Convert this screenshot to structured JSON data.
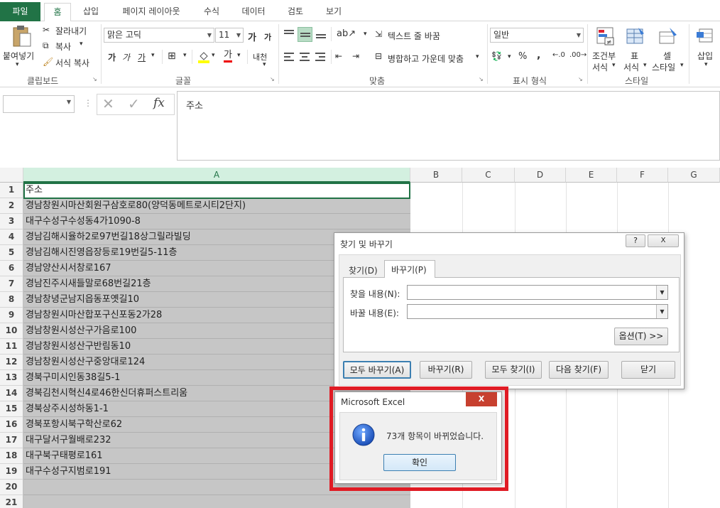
{
  "ribbon_tabs": [
    "파일",
    "홈",
    "삽입",
    "페이지 레이아웃",
    "수식",
    "데이터",
    "검토",
    "보기"
  ],
  "clipboard": {
    "paste": "붙여넣기",
    "cut": "잘라내기",
    "copy": "복사",
    "format_painter": "서식 복사",
    "group": "클립보드"
  },
  "font": {
    "name": "맑은 고딕",
    "size": "11",
    "group": "글꼴",
    "grow": "가",
    "shrink": "가",
    "bold": "가",
    "italic": "가",
    "underline": "가",
    "font_color": "가",
    "phonetic": "내천"
  },
  "alignment": {
    "wrap": "텍스트 줄 바꿈",
    "merge": "병합하고 가운데 맞춤",
    "group": "맞춤"
  },
  "number": {
    "format": "일반",
    "percent": "%",
    "comma": ",",
    "group": "표시 형식"
  },
  "styles": {
    "conditional": "조건부",
    "conditional2": "서식",
    "table": "표",
    "table2": "서식",
    "cell": "셀",
    "cell2": "스타일",
    "group": "스타일"
  },
  "cells": {
    "insert": "삽입"
  },
  "formula": {
    "namebox": "",
    "fx": "fx",
    "content": "주소"
  },
  "columns": [
    "A",
    "B",
    "C",
    "D",
    "E",
    "F",
    "G"
  ],
  "rows": [
    {
      "n": "1",
      "a": "주소"
    },
    {
      "n": "2",
      "a": "경남창원시마산회원구삼호로80(양덕동메트로시티2단지)"
    },
    {
      "n": "3",
      "a": "대구수성구수성동4가1090-8"
    },
    {
      "n": "4",
      "a": "경남김해시율하2로97번길18상그릴라빌딩"
    },
    {
      "n": "5",
      "a": "경남김해시진영읍장등로19번길5-11층"
    },
    {
      "n": "6",
      "a": "경남양산시서창로167"
    },
    {
      "n": "7",
      "a": "경남진주시새들말로68번길21층"
    },
    {
      "n": "8",
      "a": "경남창녕군남지읍동포옛길10"
    },
    {
      "n": "9",
      "a": "경남창원시마산합포구신포동2가28"
    },
    {
      "n": "10",
      "a": "경남창원시성산구가음로100"
    },
    {
      "n": "11",
      "a": "경남창원시성산구반림동10"
    },
    {
      "n": "12",
      "a": "경남창원시성산구중앙대로124"
    },
    {
      "n": "13",
      "a": "경북구미시인동38길5-1"
    },
    {
      "n": "14",
      "a": "경북김천시혁신4로46한신더휴퍼스트리움"
    },
    {
      "n": "15",
      "a": "경북상주시성하동1-1"
    },
    {
      "n": "16",
      "a": "경북포항시북구학산로62"
    },
    {
      "n": "17",
      "a": "대구달서구월배로232"
    },
    {
      "n": "18",
      "a": "대구북구태평로161"
    },
    {
      "n": "19",
      "a": "대구수성구지범로191"
    },
    {
      "n": "20",
      "a": ""
    },
    {
      "n": "21",
      "a": ""
    }
  ],
  "find_dialog": {
    "title": "찾기 및 바꾸기",
    "help": "?",
    "close": "X",
    "tab_find": "찾기(D)",
    "tab_replace": "바꾸기(P)",
    "find_label": "찾을 내용(N):",
    "replace_label": "바꿀 내용(E):",
    "find_value": "",
    "replace_value": "",
    "options": "옵션(T) >>",
    "replace_all": "모두 바꾸기(A)",
    "replace": "바꾸기(R)",
    "find_all": "모두 찾기(I)",
    "find_next": "다음 찾기(F)",
    "close_btn": "닫기"
  },
  "message_box": {
    "title": "Microsoft Excel",
    "close": "X",
    "message": "73개 항목이 바뀌었습니다.",
    "ok": "확인"
  },
  "colors": {
    "excel_green": "#217346",
    "selection_gray": "#c6c6c6",
    "highlight_red": "#e01b24"
  }
}
